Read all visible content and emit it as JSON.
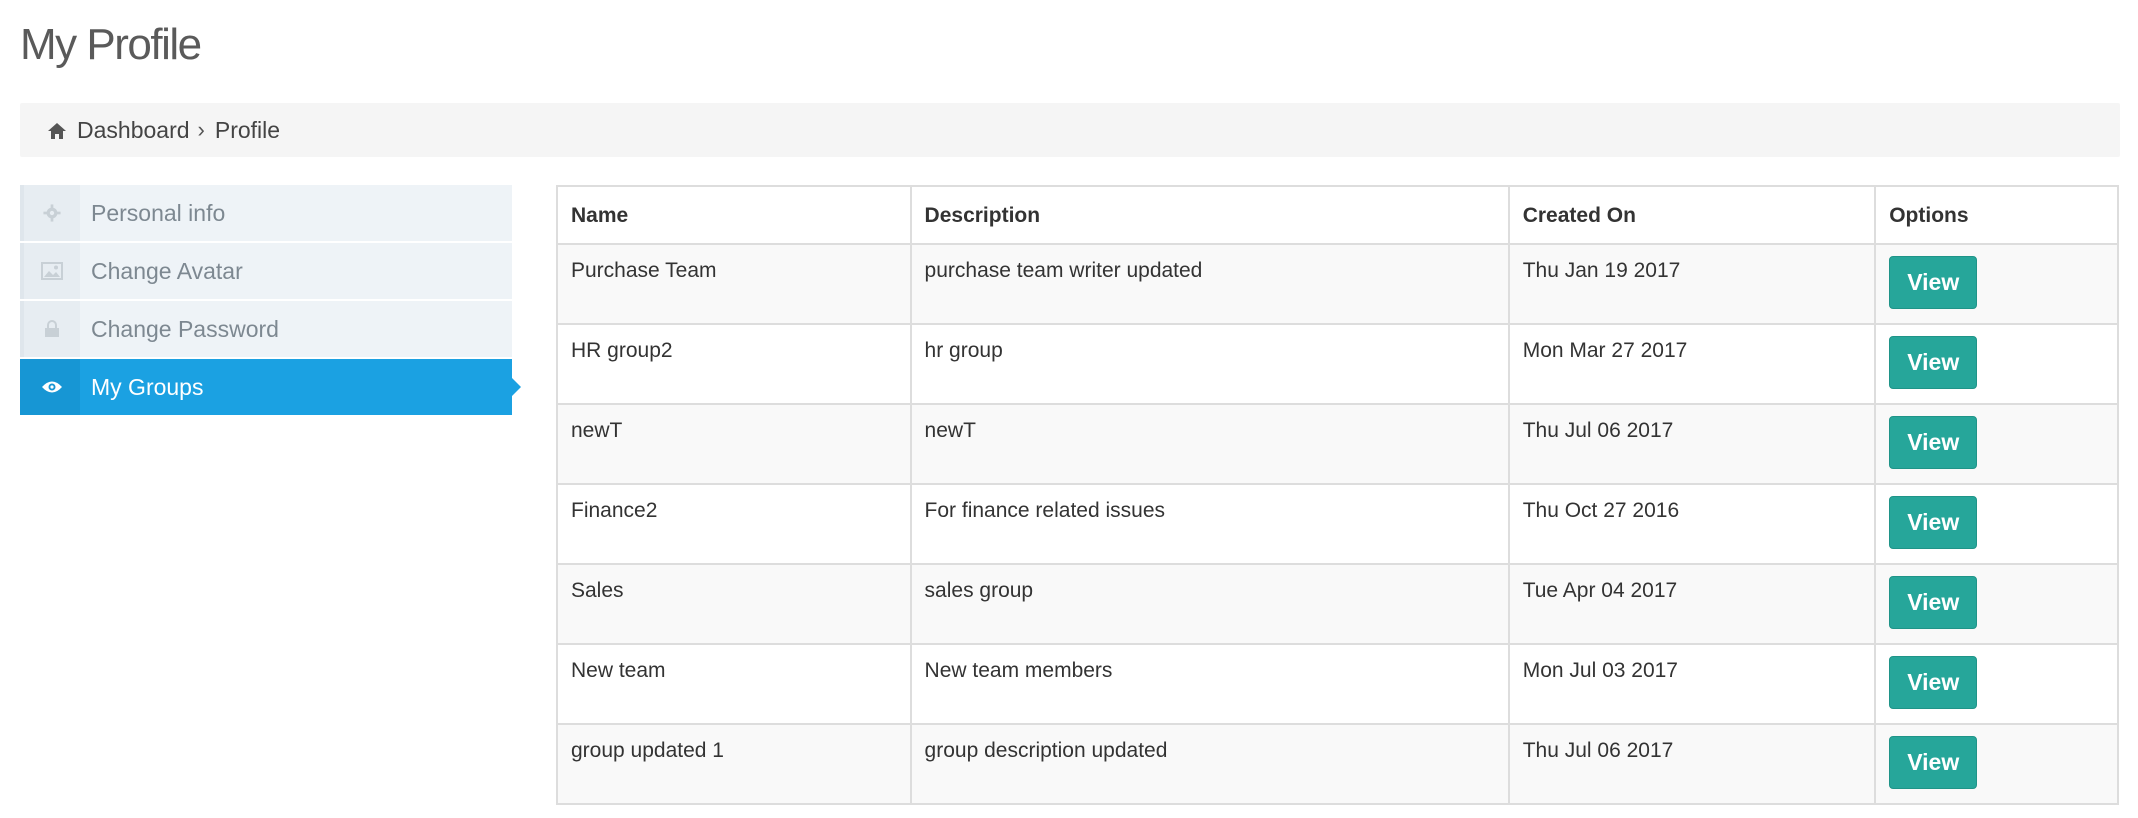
{
  "page": {
    "title": "My Profile"
  },
  "breadcrumb": {
    "home": "Dashboard",
    "separator": "›",
    "current": "Profile"
  },
  "sidebar": {
    "items": [
      {
        "label": "Personal info",
        "icon": "gear-icon",
        "active": false
      },
      {
        "label": "Change Avatar",
        "icon": "image-icon",
        "active": false
      },
      {
        "label": "Change Password",
        "icon": "lock-icon",
        "active": false
      },
      {
        "label": "My Groups",
        "icon": "eye-icon",
        "active": true
      }
    ],
    "active_color": "#1ba1e2"
  },
  "groups_table": {
    "headers": [
      "Name",
      "Description",
      "Created On",
      "Options"
    ],
    "rows": [
      {
        "name": "Purchase Team",
        "description": "purchase team writer updated",
        "created": "Thu Jan 19 2017",
        "action": "View"
      },
      {
        "name": "HR group2",
        "description": "hr group",
        "created": "Mon Mar 27 2017",
        "action": "View"
      },
      {
        "name": "newT",
        "description": "newT",
        "created": "Thu Jul 06 2017",
        "action": "View"
      },
      {
        "name": "Finance2",
        "description": "For finance related issues",
        "created": "Thu Oct 27 2016",
        "action": "View"
      },
      {
        "name": "Sales",
        "description": "sales group",
        "created": "Tue Apr 04 2017",
        "action": "View"
      },
      {
        "name": "New team",
        "description": "New team members",
        "created": "Mon Jul 03 2017",
        "action": "View"
      },
      {
        "name": "group updated 1",
        "description": "group description updated",
        "created": "Thu Jul 06 2017",
        "action": "View"
      }
    ],
    "button_color": "#26a69a"
  }
}
